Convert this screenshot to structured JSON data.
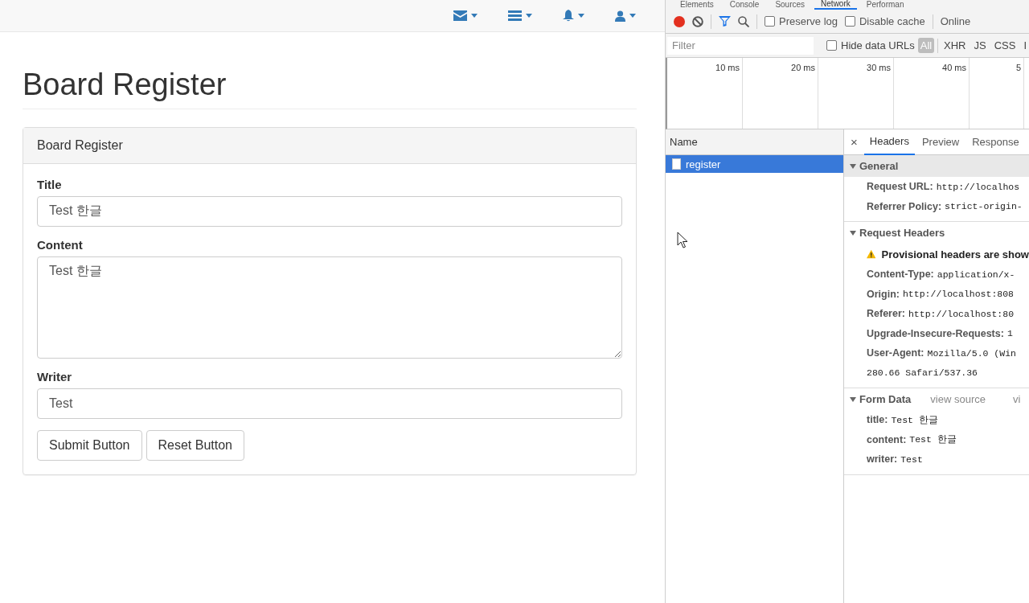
{
  "page": {
    "heading": "Board Register",
    "panel": {
      "heading": "Board Register",
      "fields": [
        {
          "label": "Title",
          "kind": "input",
          "value": "Test 한글"
        },
        {
          "label": "Content",
          "kind": "textarea",
          "value": "Test 한글"
        },
        {
          "label": "Writer",
          "kind": "input",
          "value": "Test"
        }
      ],
      "buttons": [
        "Submit Button",
        "Reset Button"
      ]
    }
  },
  "devtools": {
    "tabs": [
      {
        "label": "Elements",
        "selected": false
      },
      {
        "label": "Console",
        "selected": false
      },
      {
        "label": "Sources",
        "selected": false
      },
      {
        "label": "Network",
        "selected": true
      },
      {
        "label": "Performan",
        "selected": false
      }
    ],
    "toolbar": {
      "recording": true,
      "preserve_log": {
        "label": "Preserve log",
        "checked": false
      },
      "disable_cache": {
        "label": "Disable cache",
        "checked": false
      },
      "throttling": "Online"
    },
    "filter": {
      "placeholder": "Filter",
      "hide_data_urls": {
        "label": "Hide data URLs",
        "checked": false
      },
      "types": [
        {
          "label": "All",
          "selected": true
        },
        {
          "label": "XHR",
          "selected": false
        },
        {
          "label": "JS",
          "selected": false
        },
        {
          "label": "CSS",
          "selected": false
        },
        {
          "label": "I",
          "selected": false
        }
      ]
    },
    "timeline": {
      "ticks": [
        "10 ms",
        "20 ms",
        "30 ms",
        "40 ms",
        "5"
      ]
    },
    "requests": {
      "column": "Name",
      "rows": [
        {
          "name": "register",
          "selected": true
        }
      ]
    },
    "details": {
      "close": "×",
      "tabs": [
        {
          "label": "Headers",
          "selected": true
        },
        {
          "label": "Preview",
          "selected": false
        },
        {
          "label": "Response",
          "selected": false
        }
      ],
      "sections": [
        {
          "title": "General",
          "expanded": true,
          "rows": [
            {
              "kind": "header",
              "key": "Request URL:",
              "value": "http://localhos"
            },
            {
              "kind": "header",
              "key": "Referrer Policy:",
              "value": "strict-origin-"
            }
          ]
        },
        {
          "title": "Request Headers",
          "expanded": true,
          "warning": "Provisional headers are show",
          "rows": [
            {
              "kind": "header",
              "key": "Content-Type:",
              "value": "application/x-"
            },
            {
              "kind": "header",
              "key": "Origin:",
              "value": "http://localhost:808"
            },
            {
              "kind": "header",
              "key": "Referer:",
              "value": "http://localhost:80"
            },
            {
              "kind": "header",
              "key": "Upgrade-Insecure-Requests:",
              "value": "1"
            },
            {
              "kind": "header",
              "key": "User-Agent:",
              "value": "Mozilla/5.0 (Win"
            },
            {
              "kind": "continuation",
              "value": "280.66 Safari/537.36"
            }
          ]
        },
        {
          "title": "Form Data",
          "expanded": true,
          "links": [
            "view source",
            "vi"
          ],
          "rows": [
            {
              "kind": "header",
              "key": "title:",
              "value": "Test 한글"
            },
            {
              "kind": "header",
              "key": "content:",
              "value": "Test 한글"
            },
            {
              "kind": "header",
              "key": "writer:",
              "value": "Test"
            }
          ]
        }
      ]
    }
  }
}
